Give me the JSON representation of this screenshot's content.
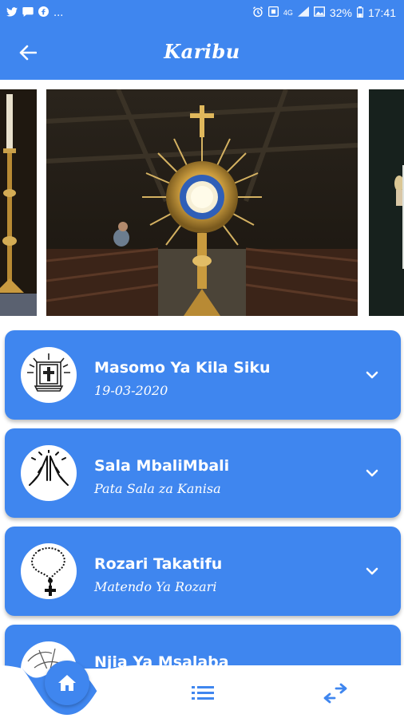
{
  "status_bar": {
    "left_icons": [
      "twitter-icon",
      "chat-icon",
      "facebook-icon"
    ],
    "more": "...",
    "network": "4G",
    "battery": "32%",
    "time": "17:41"
  },
  "app_bar": {
    "title": "Karibu",
    "back_icon": "arrow-left-icon"
  },
  "carousel": {
    "slides": [
      "candlestick-image",
      "monstrance-image",
      "candle-image"
    ]
  },
  "menu": [
    {
      "title": "Masomo Ya Kila Siku",
      "subtitle": "19-03-2020",
      "icon": "bible-icon"
    },
    {
      "title": "Sala MbaliMbali",
      "subtitle": "Pata Sala za Kanisa",
      "icon": "praying-hands-icon"
    },
    {
      "title": "Rozari Takatifu",
      "subtitle": "Matendo Ya Rozari",
      "icon": "rosary-icon"
    },
    {
      "title": "Njia Ya Msalaba",
      "subtitle": "",
      "icon": "stations-of-cross-icon"
    }
  ],
  "bottom_nav": {
    "items": [
      "home-icon",
      "list-icon",
      "swap-icon"
    ]
  },
  "colors": {
    "primary": "#3f86ef",
    "background": "#ffffff"
  }
}
